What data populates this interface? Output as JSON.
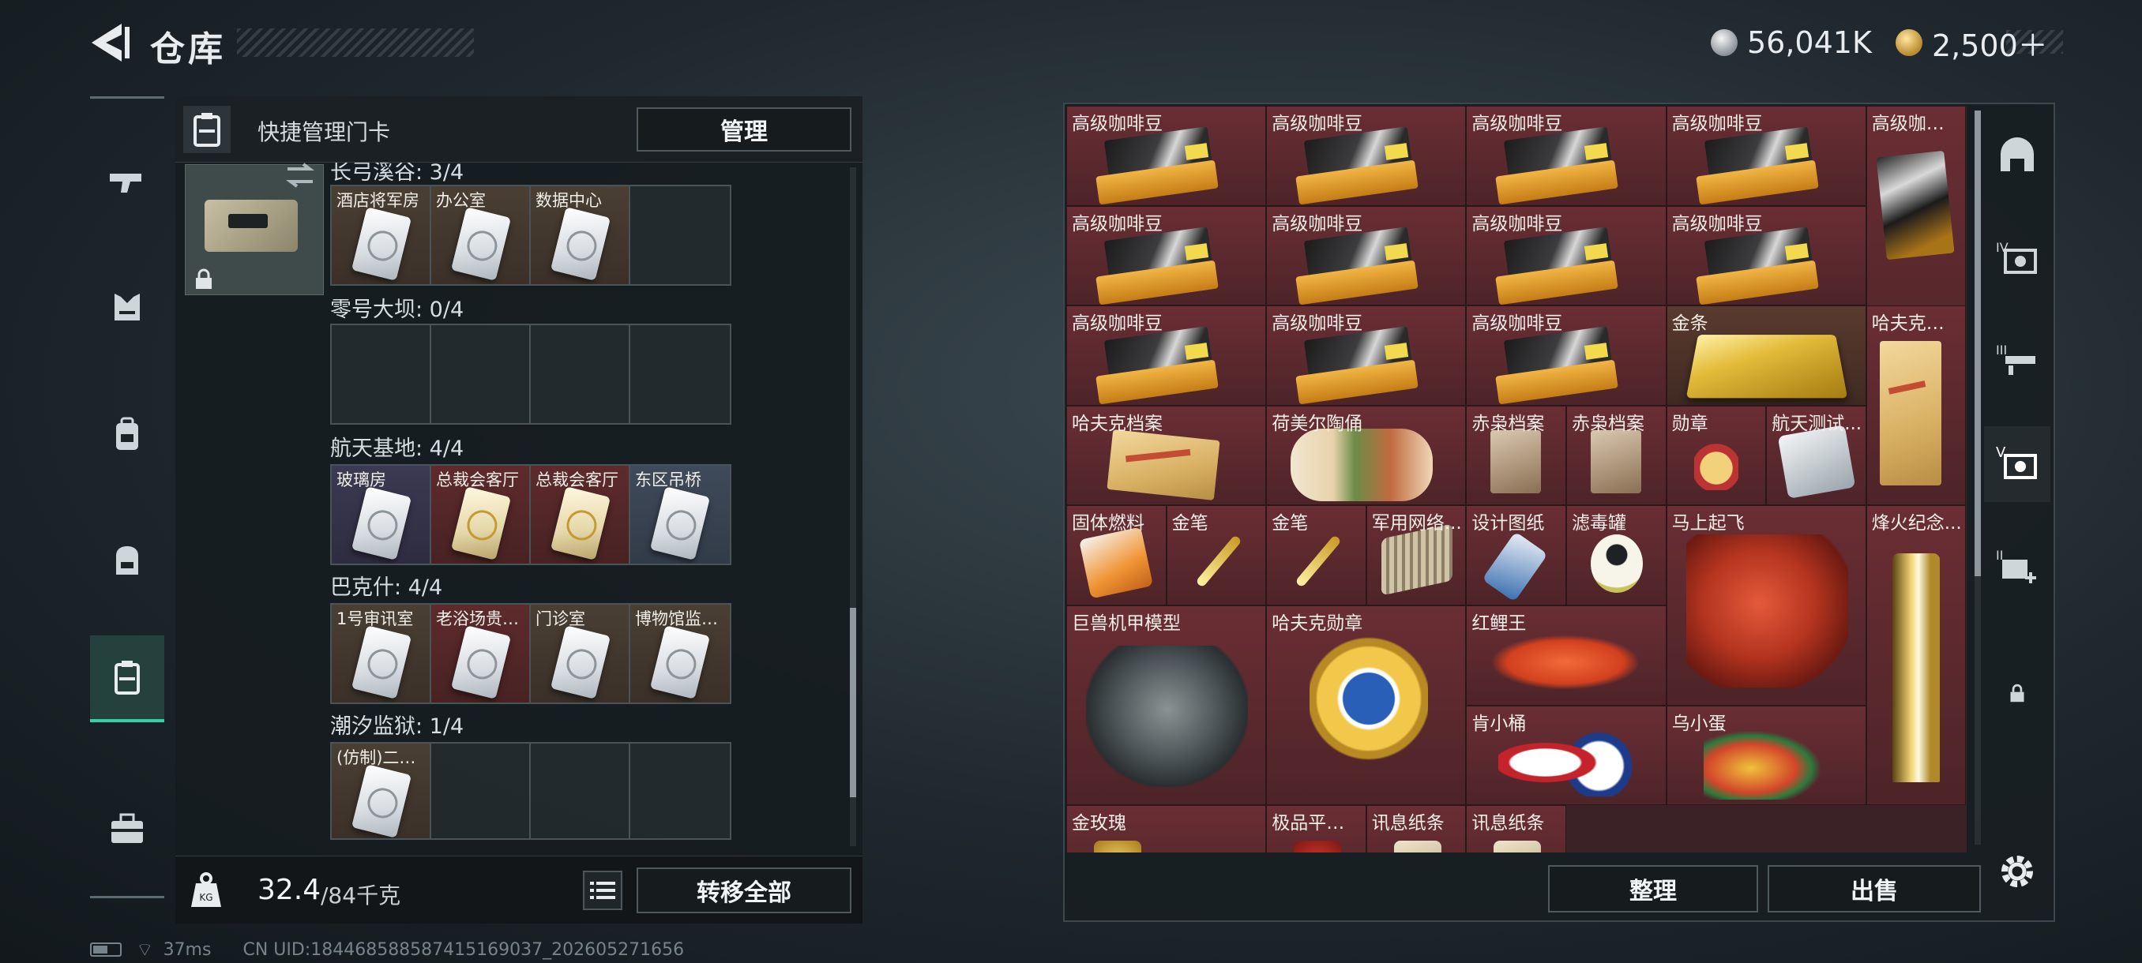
{
  "header": {
    "title": "仓库",
    "currency": [
      {
        "name": "silver",
        "value": "56,041K"
      },
      {
        "name": "gold",
        "value": "2,500＋"
      }
    ]
  },
  "left_nav": [
    "gun-icon",
    "armor-icon",
    "backpack-icon",
    "bag-icon",
    "keycard-icon",
    "toolbox-icon"
  ],
  "quick_bar": {
    "label": "快捷管理门卡",
    "manage_label": "管理"
  },
  "keycard_groups": [
    {
      "header": "长弓溪谷: 3/4",
      "slots": [
        "酒店将军房",
        "办公室",
        "数据中心",
        ""
      ]
    },
    {
      "header": "零号大坝: 0/4",
      "slots": [
        "",
        "",
        "",
        ""
      ]
    },
    {
      "header": "航天基地: 4/4",
      "slots": [
        "玻璃房",
        "总裁会客厅",
        "总裁会客厅",
        "东区吊桥"
      ]
    },
    {
      "header": "巴克什: 4/4",
      "slots": [
        "1号审讯室",
        "老浴场贵宾室",
        "门诊室",
        "博物馆监控室"
      ]
    },
    {
      "header": "潮汐监狱: 1/4",
      "slots": [
        "(仿制)二号牢房",
        "",
        "",
        ""
      ]
    }
  ],
  "weight": {
    "current": "32.4",
    "max": "/84千克",
    "icon": "kg-weight-icon"
  },
  "bottom_buttons": {
    "transfer_all": "转移全部",
    "sort": "整理",
    "sell": "出售"
  },
  "stash_items": [
    {
      "label": "高级咖啡豆",
      "kind": "coffee"
    },
    {
      "label": "高级咖啡豆",
      "kind": "coffee"
    },
    {
      "label": "高级咖啡豆",
      "kind": "coffee"
    },
    {
      "label": "高级咖啡豆",
      "kind": "coffee"
    },
    {
      "label": "高级咖啡豆",
      "kind": "coffee-tall"
    },
    {
      "label": "高级咖啡豆",
      "kind": "coffee"
    },
    {
      "label": "高级咖啡豆",
      "kind": "coffee"
    },
    {
      "label": "高级咖啡豆",
      "kind": "coffee"
    },
    {
      "label": "高级咖啡豆",
      "kind": "coffee"
    },
    {
      "label": "高级咖啡豆",
      "kind": "coffee"
    },
    {
      "label": "高级咖啡豆",
      "kind": "coffee"
    },
    {
      "label": "高级咖啡豆",
      "kind": "coffee"
    },
    {
      "label": "金条",
      "kind": "goldbar"
    },
    {
      "label": "哈夫克档案",
      "kind": "folder-tall"
    },
    {
      "label": "哈夫克档案",
      "kind": "folder"
    },
    {
      "label": "荷美尔陶俑",
      "kind": "figurine"
    },
    {
      "label": "赤枭档案",
      "kind": "doc-small"
    },
    {
      "label": "赤枭档案",
      "kind": "doc-small"
    },
    {
      "label": "勋章",
      "kind": "medal-small"
    },
    {
      "label": "航天测试...",
      "kind": "device"
    },
    {
      "label": "固体燃料",
      "kind": "fuel"
    },
    {
      "label": "金笔",
      "kind": "pen"
    },
    {
      "label": "金笔",
      "kind": "pen"
    },
    {
      "label": "军用网络...",
      "kind": "router"
    },
    {
      "label": "设计图纸",
      "kind": "blueprint"
    },
    {
      "label": "滤毒罐",
      "kind": "canister"
    },
    {
      "label": "马上起飞",
      "kind": "horse"
    },
    {
      "label": "烽火纪念...",
      "kind": "trophy"
    },
    {
      "label": "巨兽机甲模型",
      "kind": "mech"
    },
    {
      "label": "哈夫克勋章",
      "kind": "badge"
    },
    {
      "label": "红鲤王",
      "kind": "fish"
    },
    {
      "label": "肯小桶",
      "kind": "bucket"
    },
    {
      "label": "乌小蛋",
      "kind": "egg"
    },
    {
      "label": "金玫瑰",
      "kind": "rose"
    },
    {
      "label": "极品平安果",
      "kind": "apple"
    },
    {
      "label": "讯息纸条",
      "kind": "note"
    },
    {
      "label": "讯息纸条",
      "kind": "note"
    }
  ],
  "right_tabs": [
    "helmet-tab-icon",
    "tier4-tab-icon",
    "tier3-tab-icon",
    "tier5-tab-icon",
    "tier2-add-tab-icon",
    "lock-icon"
  ],
  "status": {
    "ping": "37ms",
    "uid": "CN UID:1844685885874151690​37_202605271656"
  }
}
